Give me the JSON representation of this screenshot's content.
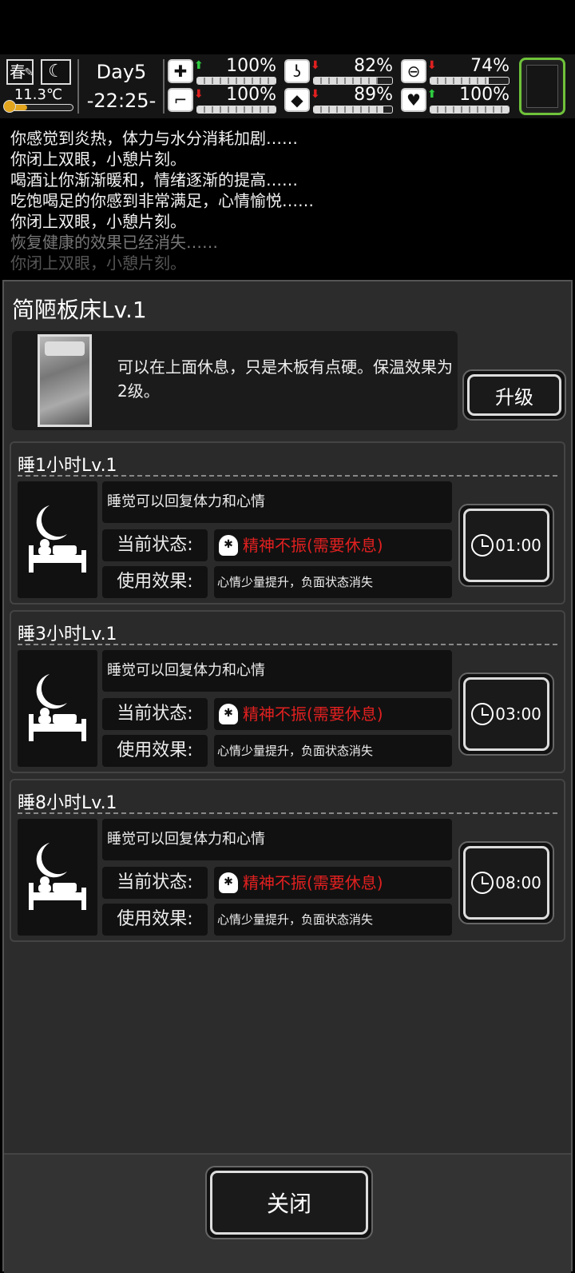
{
  "status": {
    "season": "春",
    "temperature": "11.3℃",
    "day": "Day5",
    "time": "-22:25-",
    "stats": [
      {
        "name": "health",
        "icon": "medkit-icon",
        "trend": "up",
        "value": "100%",
        "fill": 1.0
      },
      {
        "name": "hunger",
        "icon": "stomach-icon",
        "trend": "down",
        "value": "82%",
        "fill": 0.82
      },
      {
        "name": "medicine",
        "icon": "pill-icon",
        "trend": "down",
        "value": "74%",
        "fill": 0.74
      },
      {
        "name": "stamina",
        "icon": "boot-icon",
        "trend": "down",
        "value": "100%",
        "fill": 1.0
      },
      {
        "name": "thirst",
        "icon": "water-drop-icon",
        "trend": "down",
        "value": "89%",
        "fill": 0.89
      },
      {
        "name": "mood",
        "icon": "heart-icon",
        "trend": "up",
        "value": "100%",
        "fill": 1.0
      }
    ]
  },
  "log": [
    "你感觉到炎热，体力与水分消耗加剧……",
    "你闭上双眼，小憩片刻。",
    "喝酒让你渐渐暖和，情绪逐渐的提高……",
    "吃饱喝足的你感到非常满足，心情愉悦……",
    "你闭上双眼，小憩片刻。",
    "恢复健康的效果已经消失……",
    "你闭上双眼，小憩片刻。"
  ],
  "panel": {
    "title": "简陋板床Lv.1",
    "description": "可以在上面休息，只是木板有点硬。保温效果为2级。",
    "upgrade_label": "升级",
    "close_label": "关闭"
  },
  "sleep_options": [
    {
      "title": "睡1小时Lv.1",
      "desc": "睡觉可以回复体力和心情",
      "status_label": "当前状态:",
      "status": "精神不振(需要休息)",
      "effect_label": "使用效果:",
      "effect": "心情少量提升，负面状态消失",
      "duration": "01:00"
    },
    {
      "title": "睡3小时Lv.1",
      "desc": "睡觉可以回复体力和心情",
      "status_label": "当前状态:",
      "status": "精神不振(需要休息)",
      "effect_label": "使用效果:",
      "effect": "心情少量提升，负面状态消失",
      "duration": "03:00"
    },
    {
      "title": "睡8小时Lv.1",
      "desc": "睡觉可以回复体力和心情",
      "status_label": "当前状态:",
      "status": "精神不振(需要休息)",
      "effect_label": "使用效果:",
      "effect": "心情少量提升，负面状态消失",
      "duration": "08:00"
    }
  ],
  "colors": {
    "accent_green": "#6fc23a",
    "warning_red": "#e02020",
    "temp_orange": "#e3a51e",
    "up_green": "#2ecc40"
  }
}
